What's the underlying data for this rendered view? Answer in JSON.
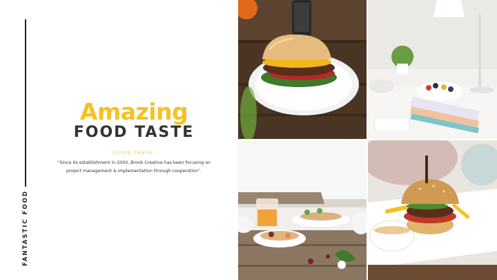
{
  "side_label": "FANTASTIC FOOD",
  "title": {
    "main": "Amazing",
    "sub": "FOOD TASTE",
    "tagline": "-FOOD TASTE-",
    "description": "“Since its establishment in 2000, Brook Creative has been focusing on project management & implementation through cooperation”."
  },
  "colors": {
    "accent": "#f7c11e",
    "text": "#333333",
    "line": "#1f1f1f"
  }
}
